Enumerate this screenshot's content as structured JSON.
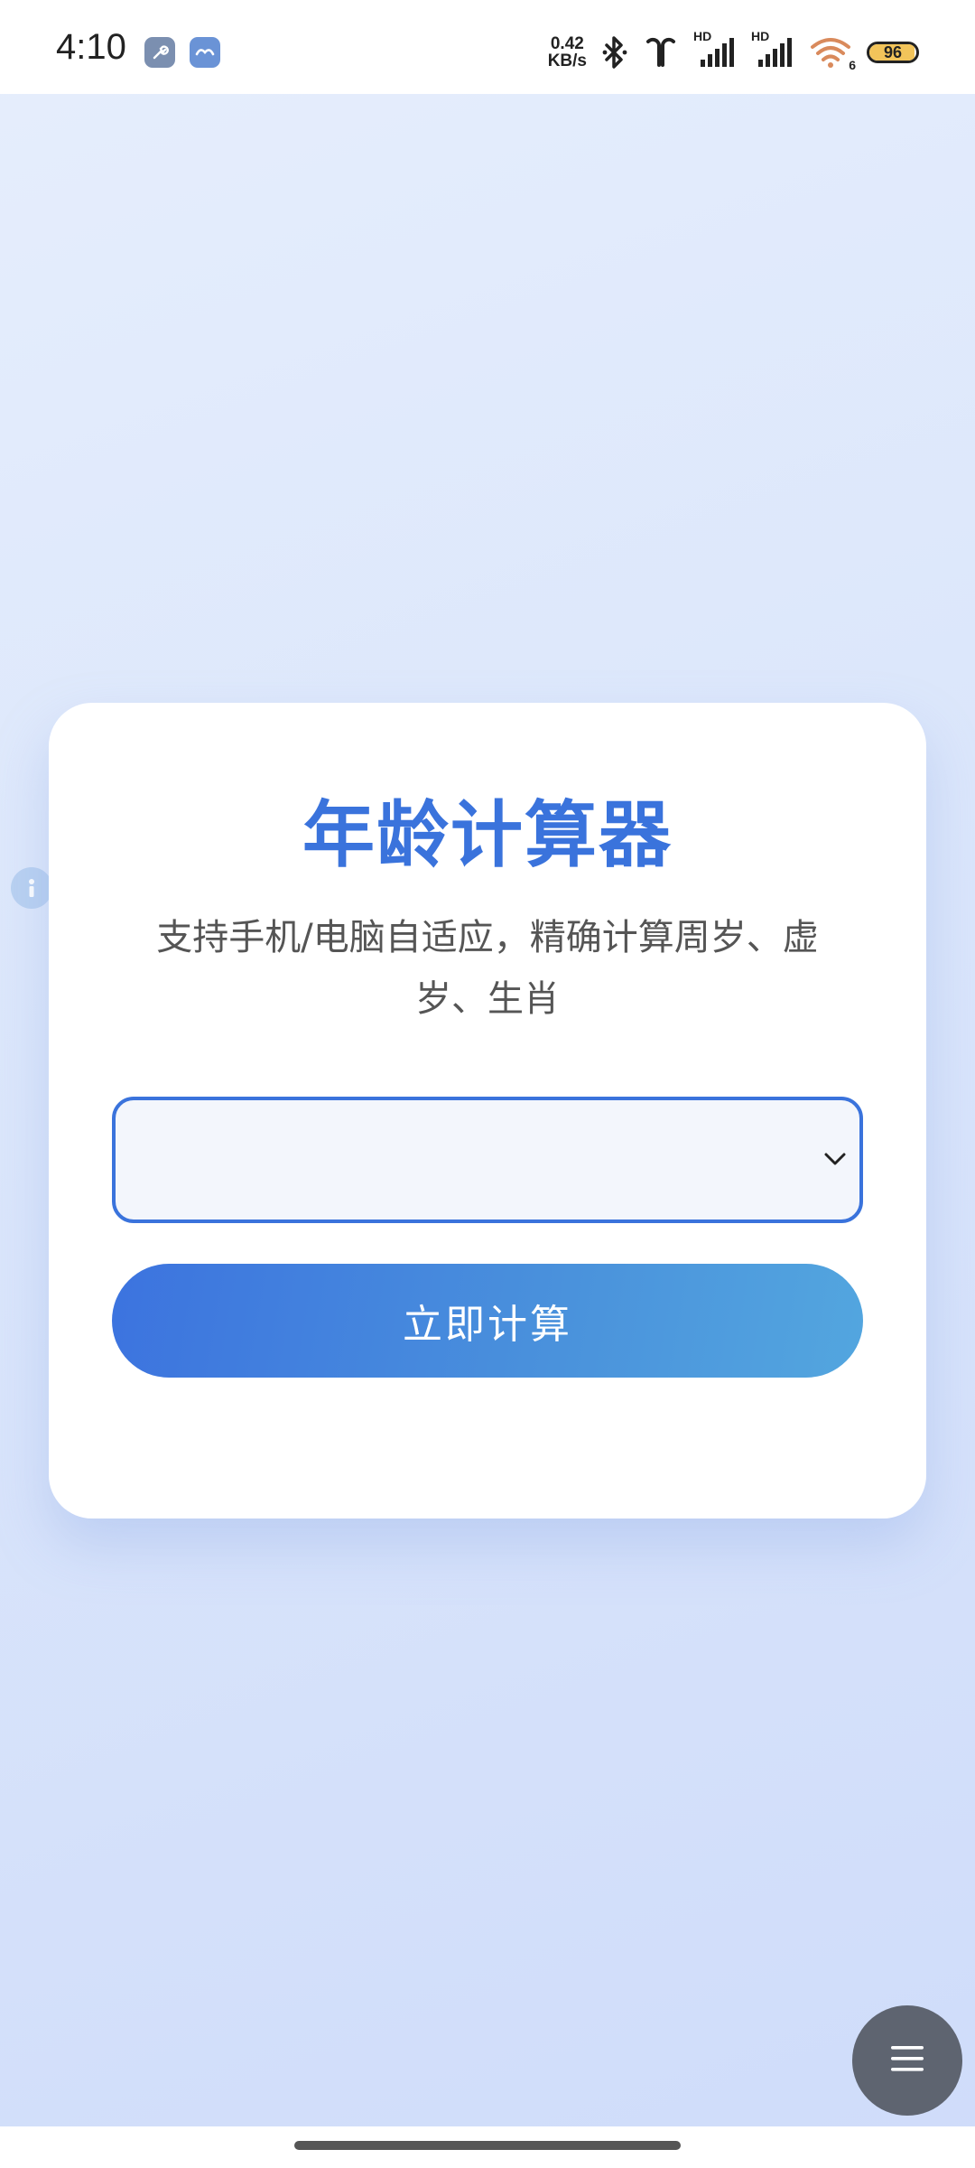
{
  "status_bar": {
    "time": "4:10",
    "app_icons": [
      "wrench-app-icon",
      "bird-app-icon"
    ],
    "net_speed_value": "0.42",
    "net_speed_unit": "KB/s",
    "signal_label_1": "HD",
    "signal_label_2": "HD",
    "wifi_label": "6",
    "battery_level": "96",
    "battery_color": "#f2c45a"
  },
  "card": {
    "title": "年龄计算器",
    "subtitle": "支持手机/电脑自适应，精确计算周岁、虚岁、生肖",
    "select": {
      "value": ""
    },
    "button_label": "立即计算"
  },
  "colors": {
    "accent": "#3a73dc",
    "fab": "#5e6470"
  },
  "icons": {
    "side": "info-icon",
    "fab": "menu-icon"
  }
}
